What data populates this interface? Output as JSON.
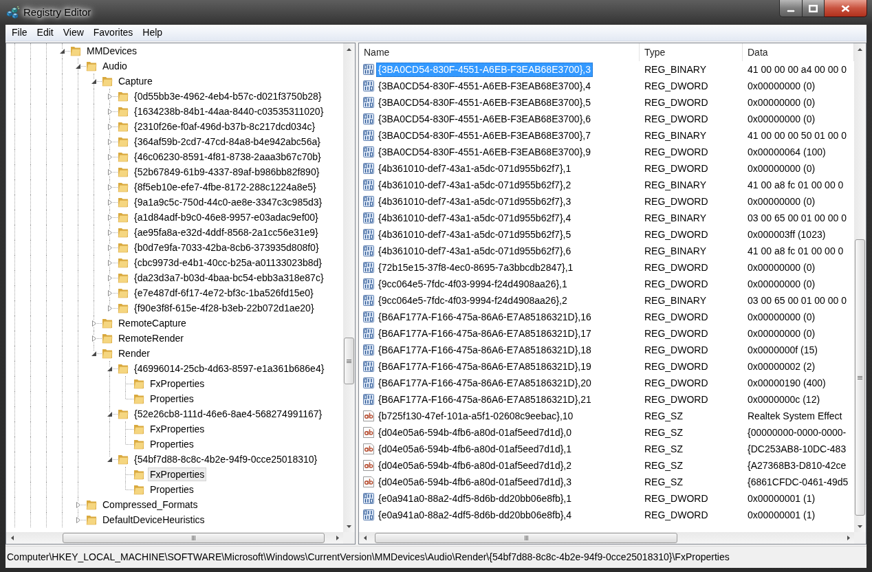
{
  "window": {
    "title": "Registry Editor"
  },
  "menu": [
    "File",
    "Edit",
    "View",
    "Favorites",
    "Help"
  ],
  "tree": {
    "items": [
      {
        "label": "MMDevices",
        "expanded": true,
        "selected": false,
        "children": [
          {
            "label": "Audio",
            "expanded": true,
            "selected": false,
            "children": [
              {
                "label": "Capture",
                "expanded": true,
                "selected": false,
                "children": [
                  {
                    "label": "{0d55bb3e-4962-4eb4-b57c-d021f3750b28}",
                    "expanded": false,
                    "selected": false
                  },
                  {
                    "label": "{1634238b-84b1-44aa-8440-c03535311020}",
                    "expanded": false,
                    "selected": false
                  },
                  {
                    "label": "{2310f26e-f0af-496d-b37b-8c217dcd034c}",
                    "expanded": false,
                    "selected": false
                  },
                  {
                    "label": "{364af59b-2cd7-47cd-84a8-b4e942abc56a}",
                    "expanded": false,
                    "selected": false
                  },
                  {
                    "label": "{46c06230-8591-4f81-8738-2aaa3b67c70b}",
                    "expanded": false,
                    "selected": false
                  },
                  {
                    "label": "{52b67849-61b9-4337-89af-b986bb82f890}",
                    "expanded": false,
                    "selected": false
                  },
                  {
                    "label": "{8f5eb10e-efe7-4fbe-8172-288c1224a8e5}",
                    "expanded": false,
                    "selected": false
                  },
                  {
                    "label": "{9a1a9c5c-750d-44c0-ae8e-3347c3c985d3}",
                    "expanded": false,
                    "selected": false
                  },
                  {
                    "label": "{a1d84adf-b9c0-46e8-9957-e03adac9ef00}",
                    "expanded": false,
                    "selected": false
                  },
                  {
                    "label": "{ae95fa8a-e32d-4ddf-8568-2a1cc56e31e9}",
                    "expanded": false,
                    "selected": false
                  },
                  {
                    "label": "{b0d7e9fa-7033-42ba-8cb6-373935d808f0}",
                    "expanded": false,
                    "selected": false
                  },
                  {
                    "label": "{cbc9973d-e4b1-40cc-b25a-a01133023b8d}",
                    "expanded": false,
                    "selected": false
                  },
                  {
                    "label": "{da23d3a7-b03d-4baa-bc54-ebb3a318e87c}",
                    "expanded": false,
                    "selected": false
                  },
                  {
                    "label": "{e7e487df-6f17-4e72-bf3c-1ba526fd15e0}",
                    "expanded": false,
                    "selected": false
                  },
                  {
                    "label": "{f90e3f8f-615e-4f28-b3eb-22b072d1ae20}",
                    "expanded": false,
                    "selected": false
                  }
                ]
              },
              {
                "label": "RemoteCapture",
                "expanded": false,
                "selected": false
              },
              {
                "label": "RemoteRender",
                "expanded": false,
                "selected": false
              },
              {
                "label": "Render",
                "expanded": true,
                "selected": false,
                "children": [
                  {
                    "label": "{46996014-25cb-4d63-8597-e1a361b686e4}",
                    "expanded": true,
                    "selected": false,
                    "children": [
                      {
                        "label": "FxProperties",
                        "selected": false
                      },
                      {
                        "label": "Properties",
                        "selected": false
                      }
                    ]
                  },
                  {
                    "label": "{52e26cb8-111d-46e6-8ae4-568274991167}",
                    "expanded": true,
                    "selected": false,
                    "children": [
                      {
                        "label": "FxProperties",
                        "selected": false
                      },
                      {
                        "label": "Properties",
                        "selected": false
                      }
                    ]
                  },
                  {
                    "label": "{54bf7d88-8c8c-4b2e-94f9-0cce25018310}",
                    "expanded": true,
                    "selected": false,
                    "children": [
                      {
                        "label": "FxProperties",
                        "selected": true
                      },
                      {
                        "label": "Properties",
                        "selected": false
                      }
                    ]
                  }
                ]
              }
            ]
          },
          {
            "label": "Compressed_Formats",
            "expanded": false,
            "selected": false
          },
          {
            "label": "DefaultDeviceHeuristics",
            "expanded": false,
            "selected": false
          }
        ]
      }
    ]
  },
  "list": {
    "columns": [
      "Name",
      "Type",
      "Data"
    ],
    "rows": [
      {
        "name": "{3BA0CD54-830F-4551-A6EB-F3EAB68E3700},3",
        "type": "REG_BINARY",
        "data": "41 00 00 00 a4 00 00 0",
        "kind": "binary",
        "selected": true
      },
      {
        "name": "{3BA0CD54-830F-4551-A6EB-F3EAB68E3700},4",
        "type": "REG_DWORD",
        "data": "0x00000000 (0)",
        "kind": "binary",
        "selected": false
      },
      {
        "name": "{3BA0CD54-830F-4551-A6EB-F3EAB68E3700},5",
        "type": "REG_DWORD",
        "data": "0x00000000 (0)",
        "kind": "binary",
        "selected": false
      },
      {
        "name": "{3BA0CD54-830F-4551-A6EB-F3EAB68E3700},6",
        "type": "REG_DWORD",
        "data": "0x00000000 (0)",
        "kind": "binary",
        "selected": false
      },
      {
        "name": "{3BA0CD54-830F-4551-A6EB-F3EAB68E3700},7",
        "type": "REG_BINARY",
        "data": "41 00 00 00 50 01 00 0",
        "kind": "binary",
        "selected": false
      },
      {
        "name": "{3BA0CD54-830F-4551-A6EB-F3EAB68E3700},9",
        "type": "REG_DWORD",
        "data": "0x00000064 (100)",
        "kind": "binary",
        "selected": false
      },
      {
        "name": "{4b361010-def7-43a1-a5dc-071d955b62f7},1",
        "type": "REG_DWORD",
        "data": "0x00000000 (0)",
        "kind": "binary",
        "selected": false
      },
      {
        "name": "{4b361010-def7-43a1-a5dc-071d955b62f7},2",
        "type": "REG_BINARY",
        "data": "41 00 a8 fc 01 00 00 0",
        "kind": "binary",
        "selected": false
      },
      {
        "name": "{4b361010-def7-43a1-a5dc-071d955b62f7},3",
        "type": "REG_DWORD",
        "data": "0x00000000 (0)",
        "kind": "binary",
        "selected": false
      },
      {
        "name": "{4b361010-def7-43a1-a5dc-071d955b62f7},4",
        "type": "REG_BINARY",
        "data": "03 00 65 00 01 00 00 0",
        "kind": "binary",
        "selected": false
      },
      {
        "name": "{4b361010-def7-43a1-a5dc-071d955b62f7},5",
        "type": "REG_DWORD",
        "data": "0x000003ff (1023)",
        "kind": "binary",
        "selected": false
      },
      {
        "name": "{4b361010-def7-43a1-a5dc-071d955b62f7},6",
        "type": "REG_BINARY",
        "data": "41 00 a8 fc 01 00 00 0",
        "kind": "binary",
        "selected": false
      },
      {
        "name": "{72b15e15-37f8-4ec0-8695-7a3bbcdb2847},1",
        "type": "REG_DWORD",
        "data": "0x00000000 (0)",
        "kind": "binary",
        "selected": false
      },
      {
        "name": "{9cc064e5-7fdc-4f03-9994-f24d4908aa26},1",
        "type": "REG_DWORD",
        "data": "0x00000000 (0)",
        "kind": "binary",
        "selected": false
      },
      {
        "name": "{9cc064e5-7fdc-4f03-9994-f24d4908aa26},2",
        "type": "REG_BINARY",
        "data": "03 00 65 00 01 00 00 0",
        "kind": "binary",
        "selected": false
      },
      {
        "name": "{B6AF177A-F166-475a-86A6-E7A85186321D},16",
        "type": "REG_DWORD",
        "data": "0x00000000 (0)",
        "kind": "binary",
        "selected": false
      },
      {
        "name": "{B6AF177A-F166-475a-86A6-E7A85186321D},17",
        "type": "REG_DWORD",
        "data": "0x00000000 (0)",
        "kind": "binary",
        "selected": false
      },
      {
        "name": "{B6AF177A-F166-475a-86A6-E7A85186321D},18",
        "type": "REG_DWORD",
        "data": "0x0000000f (15)",
        "kind": "binary",
        "selected": false
      },
      {
        "name": "{B6AF177A-F166-475a-86A6-E7A85186321D},19",
        "type": "REG_DWORD",
        "data": "0x00000002 (2)",
        "kind": "binary",
        "selected": false
      },
      {
        "name": "{B6AF177A-F166-475a-86A6-E7A85186321D},20",
        "type": "REG_DWORD",
        "data": "0x00000190 (400)",
        "kind": "binary",
        "selected": false
      },
      {
        "name": "{B6AF177A-F166-475a-86A6-E7A85186321D},21",
        "type": "REG_DWORD",
        "data": "0x0000000c (12)",
        "kind": "binary",
        "selected": false
      },
      {
        "name": "{b725f130-47ef-101a-a5f1-02608c9eebac},10",
        "type": "REG_SZ",
        "data": "Realtek System Effect",
        "kind": "string",
        "selected": false
      },
      {
        "name": "{d04e05a6-594b-4fb6-a80d-01af5eed7d1d},0",
        "type": "REG_SZ",
        "data": "{00000000-0000-0000-",
        "kind": "string",
        "selected": false
      },
      {
        "name": "{d04e05a6-594b-4fb6-a80d-01af5eed7d1d},1",
        "type": "REG_SZ",
        "data": "{DC253AB8-10DC-483",
        "kind": "string",
        "selected": false
      },
      {
        "name": "{d04e05a6-594b-4fb6-a80d-01af5eed7d1d},2",
        "type": "REG_SZ",
        "data": "{A27368B3-D810-42ce",
        "kind": "string",
        "selected": false
      },
      {
        "name": "{d04e05a6-594b-4fb6-a80d-01af5eed7d1d},3",
        "type": "REG_SZ",
        "data": "{6861CFDC-0461-49d5",
        "kind": "string",
        "selected": false
      },
      {
        "name": "{e0a941a0-88a2-4df5-8d6b-dd20bb06e8fb},1",
        "type": "REG_DWORD",
        "data": "0x00000001 (1)",
        "kind": "binary",
        "selected": false
      },
      {
        "name": "{e0a941a0-88a2-4df5-8d6b-dd20bb06e8fb},4",
        "type": "REG_DWORD",
        "data": "0x00000001 (1)",
        "kind": "binary",
        "selected": false
      }
    ]
  },
  "status_bar": "Computer\\HKEY_LOCAL_MACHINE\\SOFTWARE\\Microsoft\\Windows\\CurrentVersion\\MMDevices\\Audio\\Render\\{54bf7d88-8c8c-4b2e-94f9-0cce25018310}\\FxProperties"
}
